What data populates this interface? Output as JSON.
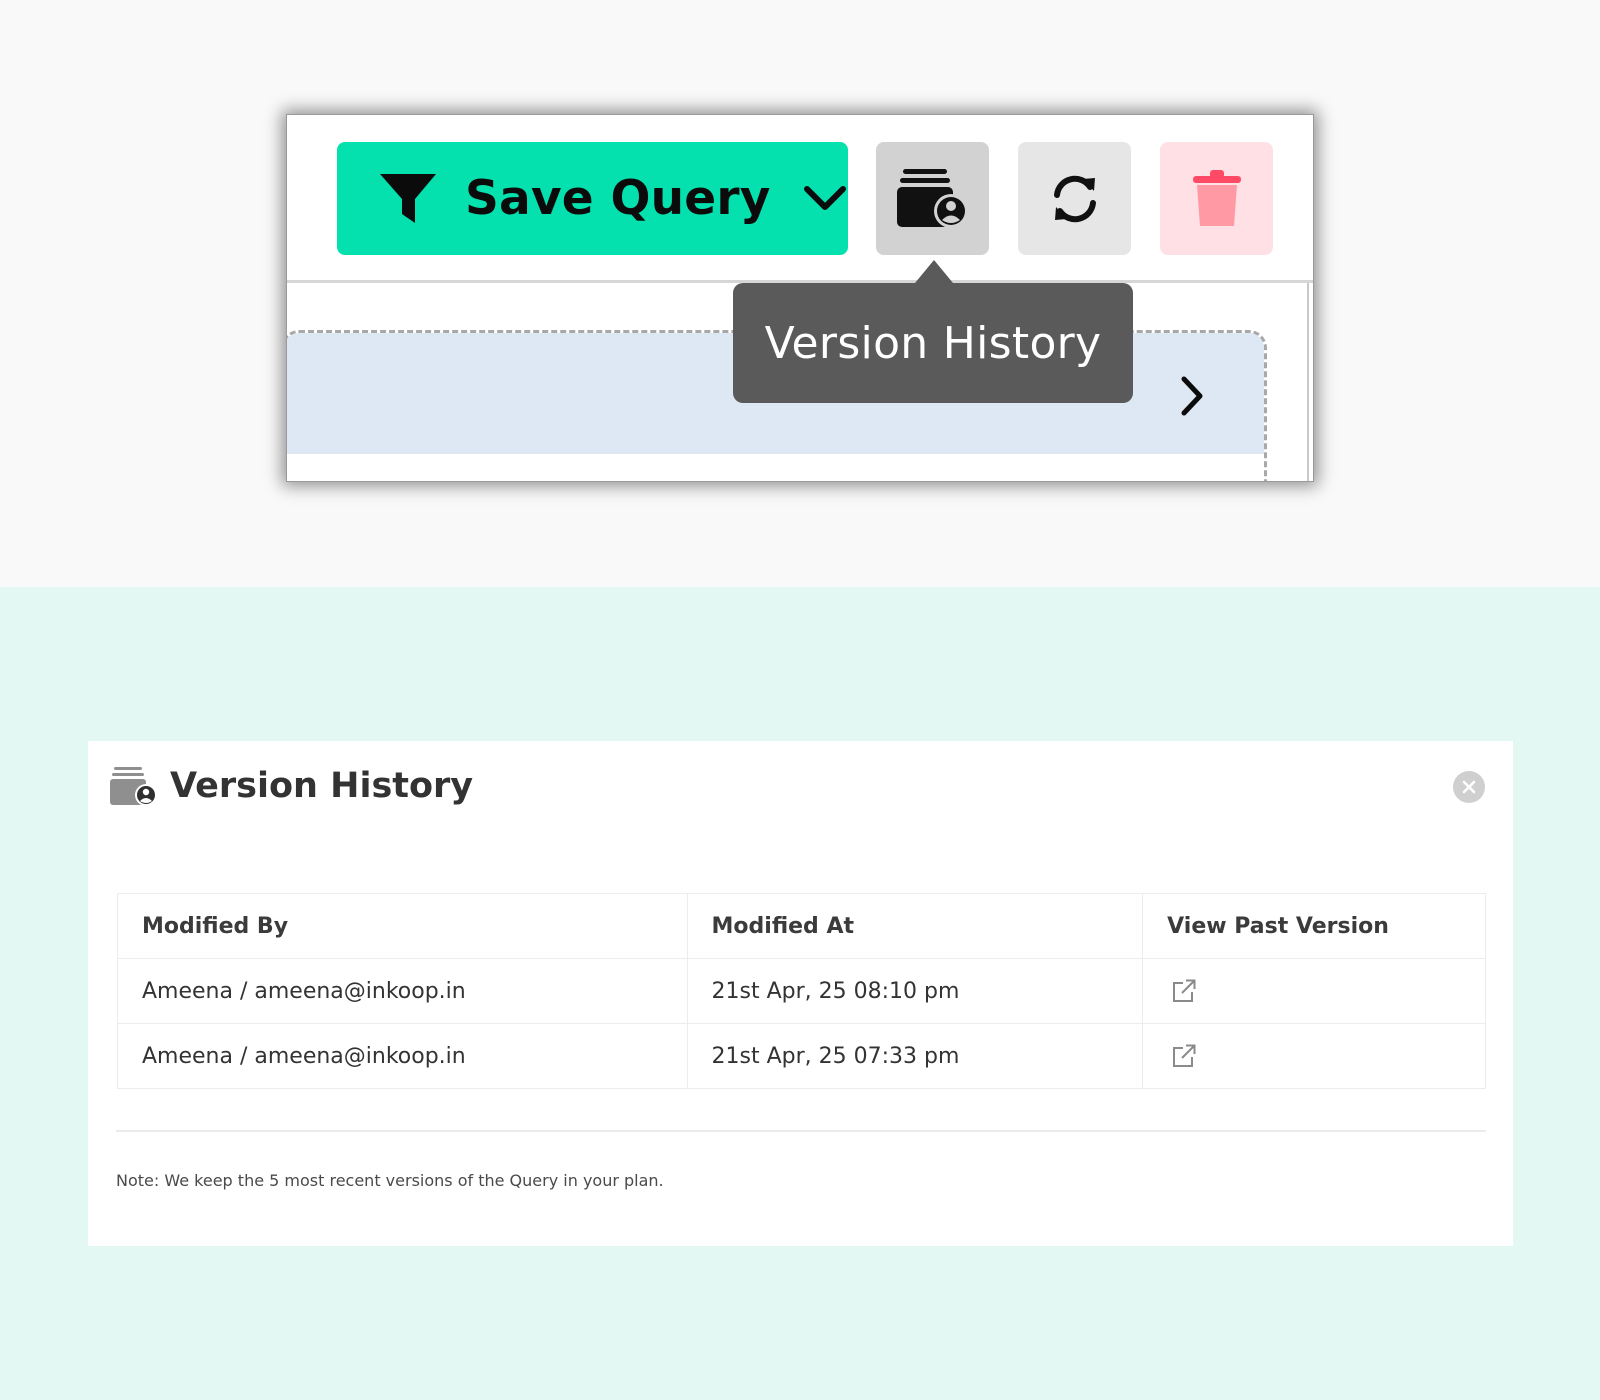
{
  "toolbar": {
    "save_query_label": "Save Query",
    "tooltip_text": "Version History",
    "icons": {
      "save": "filter-icon",
      "save_menu": "chevron-down-icon",
      "history": "version-history-icon",
      "refresh": "refresh-icon",
      "delete": "trash-icon",
      "expand": "chevron-right-icon"
    },
    "colors": {
      "save_button": "#04e0ae",
      "delete_icon": "#ff9aa5",
      "delete_icon_lid": "#ff4a66",
      "delete_button": "#ffe0e5",
      "tooltip": "#5a5a5a",
      "panel_header": "#dee8f4"
    }
  },
  "dialog": {
    "title": "Version History",
    "icons": {
      "header": "version-history-icon",
      "close": "close-icon",
      "open": "external-link-icon"
    },
    "columns": [
      "Modified By",
      "Modified At",
      "View Past Version"
    ],
    "rows": [
      {
        "modified_by": "Ameena / ameena@inkoop.in",
        "modified_at": "21st Apr, 25 08:10 pm"
      },
      {
        "modified_by": "Ameena / ameena@inkoop.in",
        "modified_at": "21st Apr, 25 07:33 pm"
      }
    ],
    "note": "Note: We keep the 5 most recent versions of the Query in your plan."
  },
  "colors": {
    "top_background": "#f9f9f9",
    "bottom_background": "#e3f8f2"
  }
}
